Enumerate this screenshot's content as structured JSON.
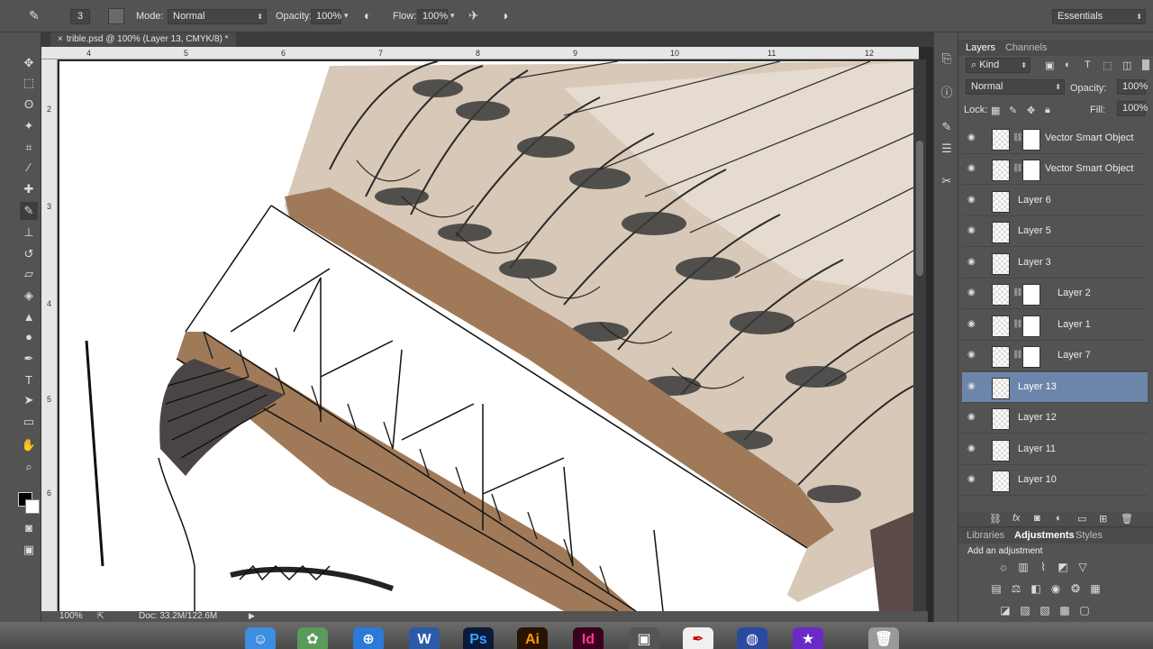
{
  "options_bar": {
    "brush_size": "3",
    "mode_label": "Mode:",
    "mode_value": "Normal",
    "opacity_label": "Opacity:",
    "opacity_value": "100%",
    "flow_label": "Flow:",
    "flow_value": "100%",
    "workspace": "Essentials"
  },
  "document": {
    "tab_title": "trible.psd @ 100% (Layer 13, CMYK/8) *",
    "ruler_top": [
      "4",
      "5",
      "6",
      "7",
      "8",
      "9",
      "10",
      "11",
      "12"
    ],
    "ruler_left": [
      "2",
      "3",
      "4",
      "5",
      "6"
    ]
  },
  "status_bar": {
    "zoom": "100%",
    "doc_info": "Doc: 33.2M/122.6M"
  },
  "layers_panel": {
    "tab_layers": "Layers",
    "tab_channels": "Channels",
    "filter_kind": "Kind",
    "blend_mode": "Normal",
    "opacity_label": "Opacity:",
    "opacity_value": "100%",
    "lock_label": "Lock:",
    "fill_label": "Fill:",
    "fill_value": "100%",
    "layers": [
      {
        "name": "Vector Smart Object",
        "mask": true,
        "selected": false
      },
      {
        "name": "Vector Smart Object",
        "mask": true,
        "selected": false
      },
      {
        "name": "Layer 6",
        "mask": false,
        "selected": false
      },
      {
        "name": "Layer 5",
        "mask": false,
        "selected": false
      },
      {
        "name": "Layer 3",
        "mask": false,
        "selected": false
      },
      {
        "name": "Layer 2",
        "mask": true,
        "selected": false
      },
      {
        "name": "Layer 1",
        "mask": true,
        "selected": false
      },
      {
        "name": "Layer 7",
        "mask": true,
        "selected": false
      },
      {
        "name": "Layer 13",
        "mask": false,
        "selected": true
      },
      {
        "name": "Layer 12",
        "mask": false,
        "selected": false
      },
      {
        "name": "Layer 11",
        "mask": false,
        "selected": false
      },
      {
        "name": "Layer 10",
        "mask": false,
        "selected": false
      }
    ]
  },
  "bottom_panel": {
    "tab_libraries": "Libraries",
    "tab_adjustments": "Adjustments",
    "tab_styles": "Styles",
    "heading": "Add an adjustment"
  },
  "dock": {
    "items": [
      "Ps",
      "Ai",
      "Id"
    ]
  },
  "colors": {
    "panel_bg": "#535353",
    "selected_layer": "#6d85aa",
    "headdress_tan": "#a07a58",
    "feather_beige": "#d8c8b8"
  }
}
